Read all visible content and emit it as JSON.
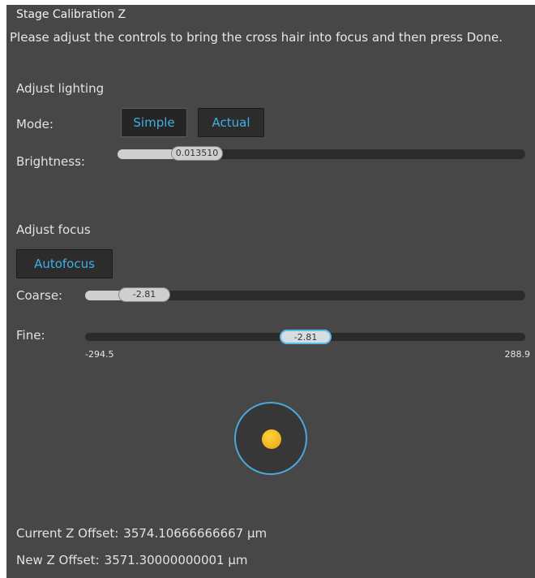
{
  "dialog": {
    "title": "Stage Calibration Z",
    "instructions": "Please adjust the controls to bring the cross hair into focus and then press Done."
  },
  "lighting": {
    "heading": "Adjust lighting",
    "mode_label": "Mode:",
    "mode_options": [
      "Simple",
      "Actual"
    ],
    "selected_mode": "Simple",
    "brightness_label": "Brightness:",
    "brightness_value": "0.013510",
    "brightness_fraction": 0.195
  },
  "focus": {
    "heading": "Adjust focus",
    "autofocus_label": "Autofocus",
    "coarse_label": "Coarse:",
    "coarse_value": "-2.81",
    "coarse_fraction": 0.135,
    "fine_label": "Fine:",
    "fine_value": "-2.81",
    "fine_fraction": 0.5,
    "fine_min": "-294.5",
    "fine_max": "288.9"
  },
  "offsets": {
    "current_label": "Current Z Offset:",
    "current_value": "3574.10666666667 µm",
    "new_label": "New Z Offset:",
    "new_value": "3571.30000000001 µm"
  },
  "colors": {
    "panel_bg": "#474747",
    "accent": "#3fb0e6",
    "knob": "#f2b51a"
  }
}
